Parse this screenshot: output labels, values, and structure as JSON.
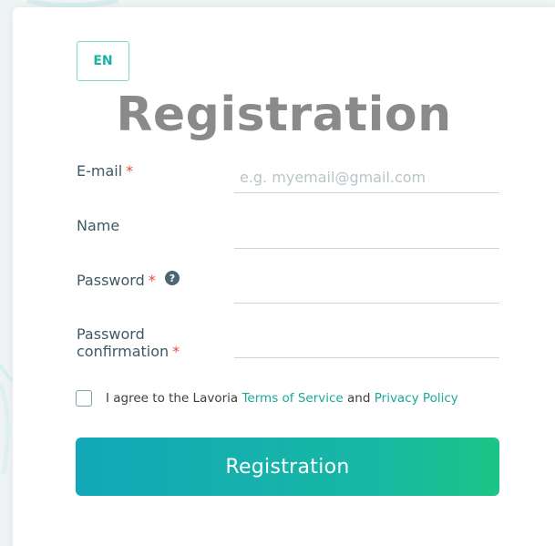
{
  "language_button": "EN",
  "title": "Registration",
  "fields": {
    "email": {
      "label": "E-mail",
      "required_mark": "*",
      "placeholder": "e.g. myemail@gmail.com",
      "value": ""
    },
    "name": {
      "label": "Name",
      "value": ""
    },
    "password": {
      "label": "Password",
      "required_mark": "*",
      "value": ""
    },
    "password_confirmation": {
      "label_line1": "Password",
      "label_line2": "confirmation",
      "required_mark": "*",
      "value": ""
    }
  },
  "agreement": {
    "prefix": "I agree to the Lavoria",
    "terms_link": "Terms of Service",
    "conjunction": "and",
    "privacy_link": "Privacy Policy",
    "checked": false
  },
  "submit_label": "Registration",
  "colors": {
    "accent": "#18b3a3",
    "link": "#19a99a",
    "required": "#e2483f",
    "title": "#8a8a8a",
    "button_gradient_start": "#12a8b8",
    "button_gradient_end": "#1cc485"
  }
}
